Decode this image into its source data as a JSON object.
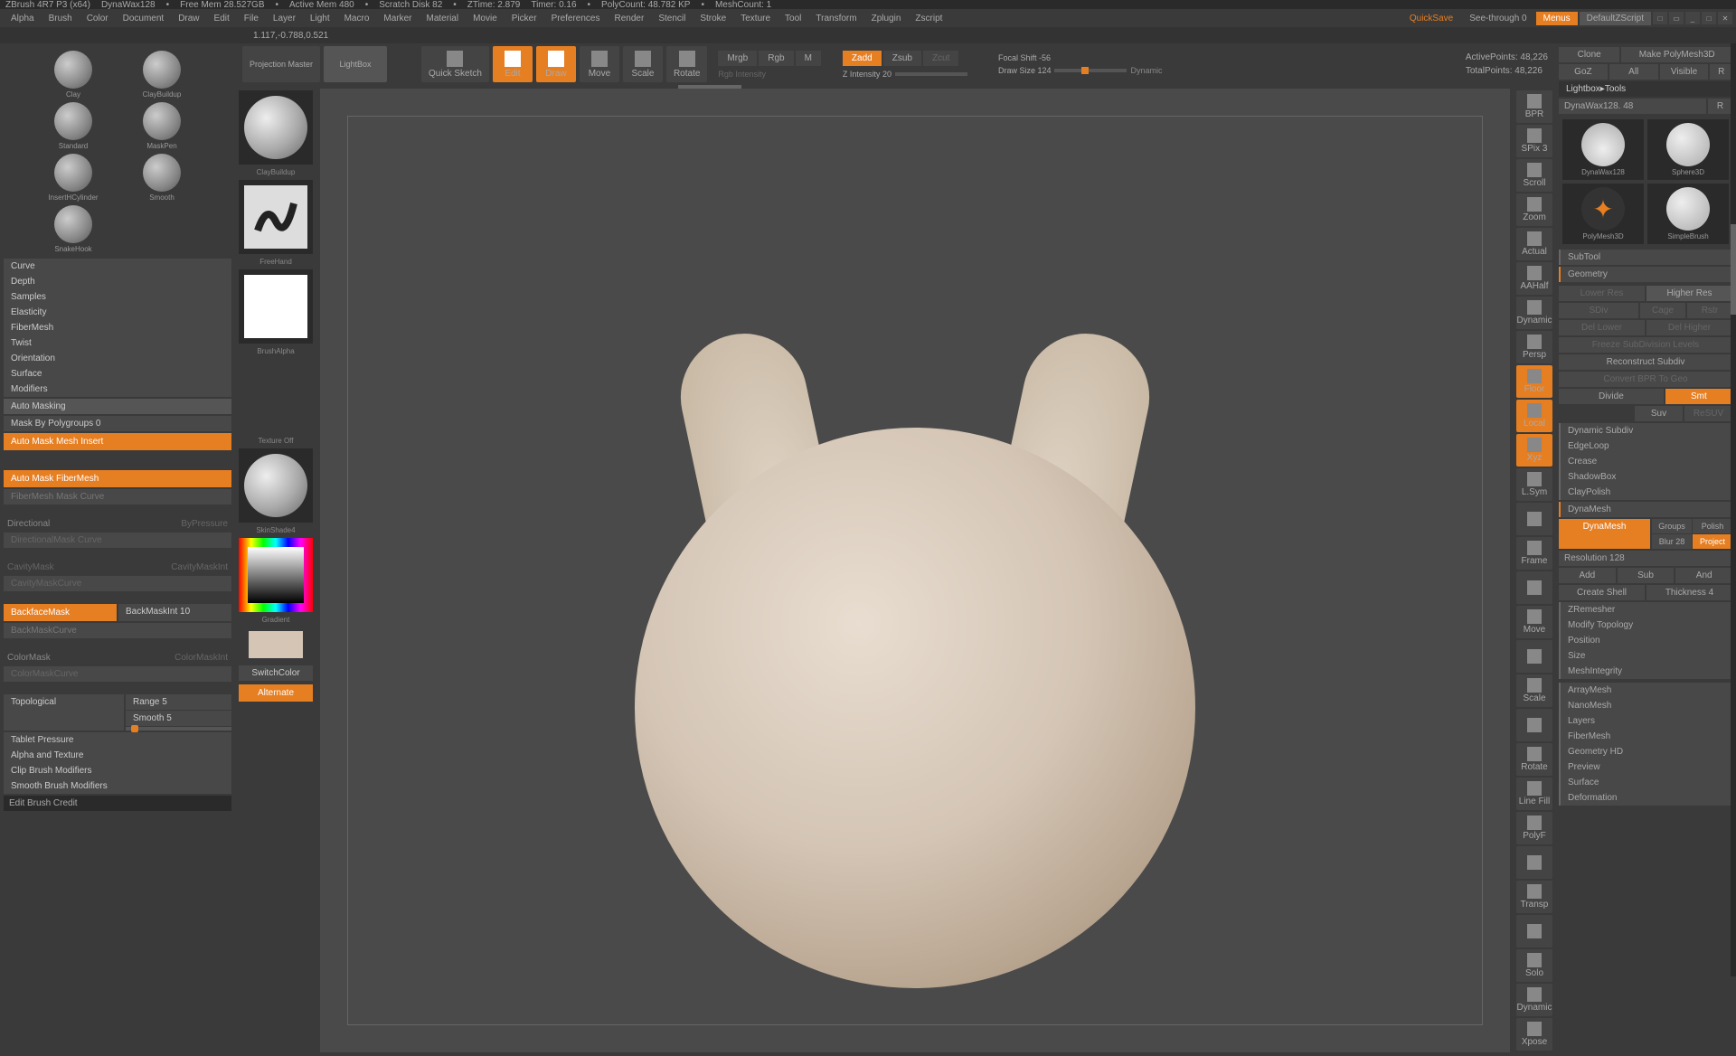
{
  "top_bar": {
    "app": "ZBrush 4R7 P3 (x64)",
    "tool": "DynaWax128",
    "mem": "Free Mem 28.527GB",
    "active": "Active Mem 480",
    "scratch": "Scratch Disk 82",
    "ztime": "ZTime: 2.879",
    "timer": "Timer: 0.16",
    "poly": "PolyCount: 48.782 KP",
    "mesh": "MeshCount: 1"
  },
  "menu": {
    "items": [
      "Alpha",
      "Brush",
      "Color",
      "Document",
      "Draw",
      "Edit",
      "File",
      "Layer",
      "Light",
      "Macro",
      "Marker",
      "Material",
      "Movie",
      "Picker",
      "Preferences",
      "Render",
      "Stencil",
      "Stroke",
      "Texture",
      "Tool",
      "Transform",
      "Zplugin",
      "Zscript"
    ],
    "quicksave": "QuickSave",
    "seethrough": "See-through  0",
    "menus": "Menus",
    "script": "DefaultZScript"
  },
  "coords": "1.117,-0.788,0.521",
  "toolbar": {
    "proj": "Projection Master",
    "lightbox": "LightBox",
    "quicksketch": "Quick Sketch",
    "edit": "Edit",
    "draw": "Draw",
    "move": "Move",
    "scale": "Scale",
    "rotate": "Rotate",
    "mrgb": "Mrgb",
    "rgb": "Rgb",
    "m": "M",
    "rgbint": "Rgb Intensity",
    "zadd": "Zadd",
    "zsub": "Zsub",
    "zcut": "Zcut",
    "zint": "Z Intensity 20",
    "focal": "Focal Shift -56",
    "drawsize": "Draw Size 124",
    "dynamic": "Dynamic",
    "active_pts": "ActivePoints: 48,226",
    "total_pts": "TotalPoints: 48,226"
  },
  "brushes": {
    "items": [
      {
        "name": "Clay"
      },
      {
        "name": "ClayBuildup"
      },
      {
        "name": "Standard"
      },
      {
        "name": "MaskPen"
      },
      {
        "name": "InsertHCylinder"
      },
      {
        "name": "Smooth"
      },
      {
        "name": "SnakeHook"
      }
    ]
  },
  "left_sections": [
    "Curve",
    "Depth",
    "Samples",
    "Elasticity",
    "FiberMesh",
    "Twist",
    "Orientation",
    "Surface",
    "Modifiers"
  ],
  "auto_mask": {
    "title": "Auto Masking",
    "poly": "Mask By Polygroups 0",
    "insert": "Auto Mask Mesh Insert",
    "fiber": "Auto Mask FiberMesh",
    "fiber_curve": "FiberMesh Mask Curve",
    "directional": "Directional",
    "bypressure": "ByPressure",
    "dir_curve": "DirectionalMask Curve",
    "cavity": "CavityMask",
    "cavity_int": "CavityMaskInt",
    "cavity_curve": "CavityMaskCurve",
    "backface": "BackfaceMask",
    "back_int": "BackMaskInt 10",
    "back_curve": "BackMaskCurve",
    "colormask": "ColorMask",
    "color_int": "ColorMaskInt",
    "color_curve": "ColorMaskCurve",
    "topo": "Topological",
    "range": "Range 5",
    "smooth": "Smooth 5"
  },
  "left_bottom": [
    "Tablet Pressure",
    "Alpha and Texture",
    "Clip Brush Modifiers",
    "Smooth Brush Modifiers"
  ],
  "edit_credit": "Edit Brush Credit",
  "left_tools": {
    "brush": "ClayBuildup",
    "stroke": "FreeHand",
    "alpha": "BrushAlpha",
    "texture": "Texture Off",
    "material": "SkinShade4",
    "gradient": "Gradient",
    "switch": "SwitchColor",
    "alternate": "Alternate"
  },
  "right_tools": [
    "BPR",
    "SPix 3",
    "Scroll",
    "Zoom",
    "Actual",
    "AAHalf",
    "Dynamic",
    "Persp",
    "Floor",
    "Local",
    "Xyz",
    "L.Sym",
    "",
    "Frame",
    "",
    "Move",
    "",
    "Scale",
    "",
    "Rotate",
    "Line Fill",
    "PolyF",
    "",
    "Transp",
    "",
    "Solo",
    "Dynamic",
    "Xpose"
  ],
  "right_panel": {
    "clone": "Clone",
    "make": "Make PolyMesh3D",
    "goz": "GoZ",
    "all": "All",
    "visible": "Visible",
    "r": "R",
    "lightbox_tools": "Lightbox▸Tools",
    "toolname": "DynaWax128. 48",
    "tools": [
      {
        "name": "DynaWax128"
      },
      {
        "name": "Sphere3D"
      },
      {
        "name": "PolyMesh3D"
      },
      {
        "name": "SimpleBrush"
      }
    ],
    "subtool": "SubTool",
    "geometry": "Geometry",
    "lower": "Lower Res",
    "higher": "Higher Res",
    "sdiv": "SDiv",
    "cage": "Cage",
    "rstr": "Rstr",
    "del_lower": "Del Lower",
    "del_higher": "Del Higher",
    "freeze": "Freeze SubDivision Levels",
    "reconstruct": "Reconstruct Subdiv",
    "convert": "Convert BPR To Geo",
    "divide": "Divide",
    "smt": "Smt",
    "suv": "Suv",
    "resuv": "ReSUV",
    "sections": [
      "Dynamic Subdiv",
      "EdgeLoop",
      "Crease",
      "ShadowBox",
      "ClayPolish"
    ],
    "dynamesh": "DynaMesh",
    "dynamesh_btn": "DynaMesh",
    "groups": "Groups",
    "polish": "Polish",
    "blur": "Blur 28",
    "project": "Project",
    "resolution": "Resolution 128",
    "add": "Add",
    "sub": "Sub",
    "and": "And",
    "shell": "Create Shell",
    "thickness": "Thickness 4",
    "sections2": [
      "ZRemesher",
      "Modify Topology",
      "Position",
      "Size",
      "MeshIntegrity"
    ],
    "sections3": [
      "ArrayMesh",
      "NanoMesh",
      "Layers",
      "FiberMesh",
      "Geometry HD",
      "Preview",
      "Surface",
      "Deformation"
    ]
  }
}
